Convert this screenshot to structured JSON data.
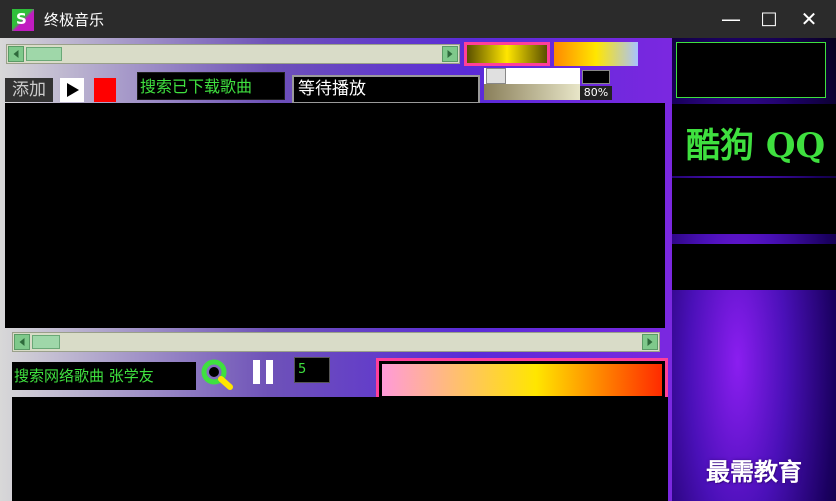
{
  "window": {
    "title": "终极音乐",
    "app_icon_letter": "S",
    "minimize_glyph": "—",
    "maximize_glyph": "□",
    "close_glyph": "✕"
  },
  "toolbar": {
    "add_label": "添加",
    "search_downloaded_label": "搜索已下载歌曲",
    "status_value": "等待播放",
    "volume_label": "80%",
    "volume_level": 0.8
  },
  "search": {
    "network_query": "搜索网络歌曲 张学友",
    "page_count": "5"
  },
  "sidebar": {
    "banner_text": "酷狗 QQ"
  },
  "watermark": {
    "text": "最需教育"
  },
  "colors": {
    "accent_green": "#3fe03f",
    "accent_pink": "#ff3f9a",
    "stop_red": "#ff0000",
    "gradient_swatch_1": [
      "#5a5000",
      "#ffe600",
      "#5a5000"
    ],
    "gradient_swatch_2": [
      "#ff8a00",
      "#ffe600",
      "#a8c2ff"
    ],
    "progress_gradient": [
      "#ff9ad9",
      "#ffe600",
      "#ff2a00"
    ]
  },
  "icons": {
    "play": "play-icon",
    "stop": "stop-icon",
    "search": "search-magnifier-icon",
    "pause": "pause-icon"
  }
}
